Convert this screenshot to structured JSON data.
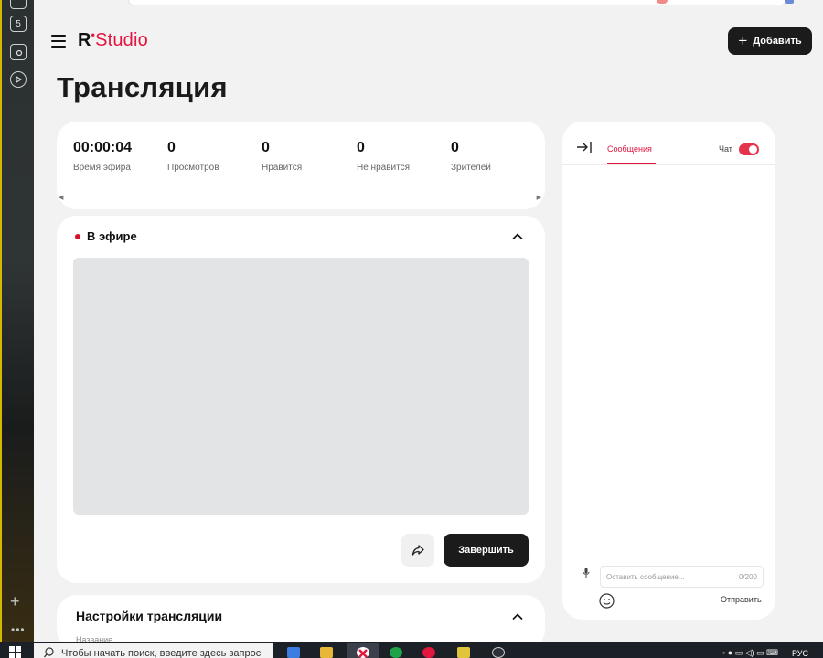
{
  "app": {
    "logo_r": "R",
    "logo_dot": "•",
    "logo_studio": "Studio",
    "add_button": "Добавить",
    "page_title": "Трансляция"
  },
  "sidebar": {
    "items": [
      {
        "icon": "browser-tab-icon"
      },
      {
        "label": "5",
        "icon": "tab-counter-icon"
      },
      {
        "icon": "screenshot-icon"
      },
      {
        "icon": "play-icon"
      }
    ]
  },
  "stats": [
    {
      "value": "00:00:04",
      "label": "Время эфира"
    },
    {
      "value": "0",
      "label": "Просмотров"
    },
    {
      "value": "0",
      "label": "Нравится"
    },
    {
      "value": "0",
      "label": "Не нравится"
    },
    {
      "value": "0",
      "label": "Зрителей"
    }
  ],
  "live": {
    "title": "В эфире",
    "end_button": "Завершить"
  },
  "settings": {
    "title": "Настройки трансляции",
    "subtitle": "Название"
  },
  "chat": {
    "tab_messages": "Сообщения",
    "chat_toggle_label": "Чат",
    "chat_enabled": true,
    "input_placeholder": "Оставить сообщение...",
    "counter": "0/200",
    "send_button": "Отправить"
  },
  "taskbar": {
    "search_placeholder": "Чтобы начать поиск, введите здесь запрос",
    "language": "РУС"
  },
  "colors": {
    "accent": "#e3163f",
    "dark": "#1b1b1b",
    "background": "#f2f2f2"
  }
}
